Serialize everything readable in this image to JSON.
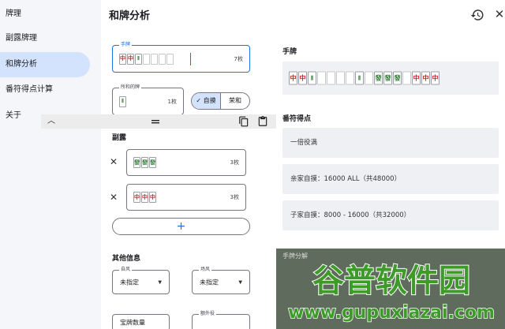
{
  "sidebar": {
    "items": [
      {
        "label": "牌理"
      },
      {
        "label": "副露牌理"
      },
      {
        "label": "和牌分析"
      },
      {
        "label": "番符得点计算"
      },
      {
        "label": "关于"
      }
    ]
  },
  "header": {
    "title": "和牌分析",
    "history_icon": "history-icon",
    "close_icon": "close-icon"
  },
  "hand_input": {
    "label": "手牌",
    "count": "7枚",
    "tiles": [
      {
        "glyph": "中",
        "color": "#c62828"
      },
      {
        "glyph": "中",
        "color": "#c62828"
      },
      {
        "glyph": "𝍪",
        "color": "#2e7d32"
      },
      {
        "glyph": "",
        "color": ""
      },
      {
        "glyph": "",
        "color": ""
      },
      {
        "glyph": "",
        "color": ""
      },
      {
        "glyph": "",
        "color": ""
      }
    ]
  },
  "winning_tile_input": {
    "label": "所和的牌",
    "count": "1枚",
    "tiles": [
      {
        "glyph": "𝍪",
        "color": "#2e7d32"
      }
    ]
  },
  "win_type": {
    "options": [
      "自摸",
      "荣和"
    ],
    "selected": "自摸"
  },
  "toolbar": {
    "collapse_icon": "chevron-up-icon",
    "drag_icon": "drag-handle-icon",
    "copy_icon": "copy-icon",
    "paste_icon": "paste-icon"
  },
  "melds": {
    "title": "副露",
    "items": [
      {
        "count": "3枚",
        "tiles": [
          {
            "glyph": "發",
            "color": "#2e7d32"
          },
          {
            "glyph": "發",
            "color": "#2e7d32"
          },
          {
            "glyph": "發",
            "color": "#2e7d32"
          }
        ]
      },
      {
        "count": "3枚",
        "tiles": [
          {
            "glyph": "中",
            "color": "#c62828"
          },
          {
            "glyph": "中",
            "color": "#c62828"
          },
          {
            "glyph": "中",
            "color": "#c62828"
          }
        ]
      }
    ],
    "add_label": "+"
  },
  "other_info": {
    "title": "其他信息",
    "round_wind": {
      "label": "自风",
      "value": "未指定"
    },
    "seat_wind": {
      "label": "场风",
      "value": "未指定"
    },
    "extra_yaku_label": "额外役",
    "dora_label": "宝牌数量"
  },
  "result": {
    "hand_title": "手牌",
    "hand_tiles": [
      {
        "glyph": "中",
        "color": "#c62828"
      },
      {
        "glyph": "中",
        "color": "#c62828"
      },
      {
        "glyph": "𝍪",
        "color": "#2e7d32"
      },
      {
        "glyph": "",
        "color": ""
      },
      {
        "glyph": "",
        "color": ""
      },
      {
        "glyph": "",
        "color": ""
      },
      {
        "glyph": "",
        "color": ""
      },
      {
        "glyph": "𝍪",
        "color": "#2e7d32"
      },
      {
        "glyph": "",
        "color": ""
      },
      {
        "glyph": "發",
        "color": "#2e7d32"
      },
      {
        "glyph": "發",
        "color": "#2e7d32"
      },
      {
        "glyph": "發",
        "color": "#2e7d32"
      },
      {
        "glyph": "",
        "color": ""
      },
      {
        "glyph": "中",
        "color": "#c62828"
      },
      {
        "glyph": "中",
        "color": "#c62828"
      },
      {
        "glyph": "中",
        "color": "#c62828"
      }
    ],
    "score_title": "番符得点",
    "cards": [
      "一倍役满",
      "亲家自摸：16000 ALL（共48000）",
      "子家自摸：8000 - 16000（共32000）"
    ],
    "breakdown_title": "手牌分解"
  },
  "watermark": {
    "text": "谷普软件园",
    "url": "www.gupuxiazai.com"
  },
  "colors": {
    "accent": "#1a73e8",
    "nav_active": "#d3e3fd",
    "dragon_red": "#c62828",
    "dragon_green": "#2e7d32",
    "watermark": "#3e9b2a"
  }
}
